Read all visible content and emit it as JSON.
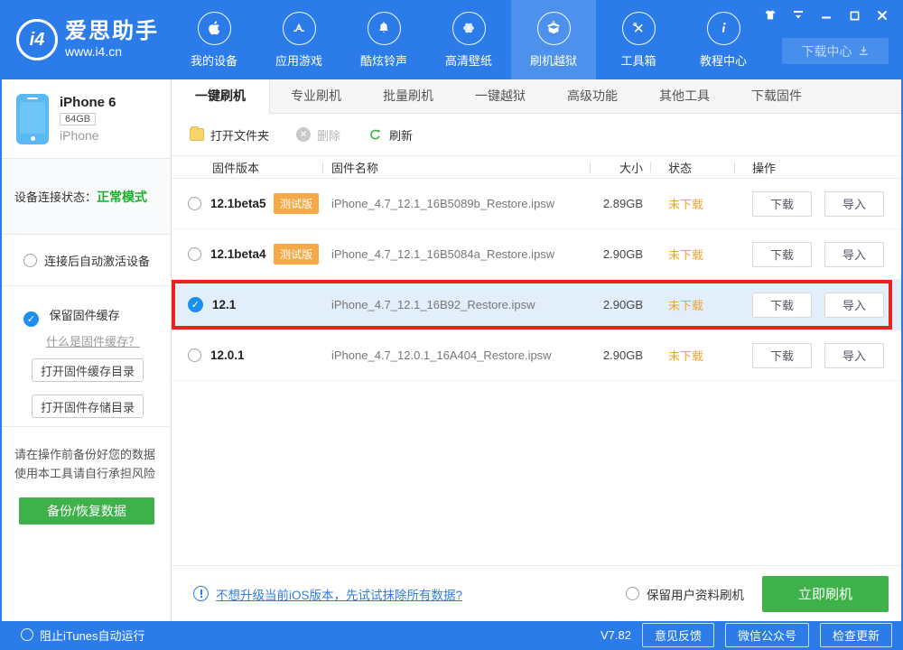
{
  "header": {
    "logo": {
      "badge": "i4",
      "title": "爱思助手",
      "subtitle": "www.i4.cn"
    },
    "nav": [
      {
        "label": "我的设备",
        "icon": "apple-icon"
      },
      {
        "label": "应用游戏",
        "icon": "appstore-icon"
      },
      {
        "label": "酷炫铃声",
        "icon": "bell-icon"
      },
      {
        "label": "高清壁纸",
        "icon": "flower-icon"
      },
      {
        "label": "刷机越狱",
        "icon": "jailbreak-box-icon",
        "active": true
      },
      {
        "label": "工具箱",
        "icon": "toolbox-icon"
      },
      {
        "label": "教程中心",
        "icon": "info-icon"
      }
    ],
    "download_center": "下载中心",
    "window_controls": [
      "skin",
      "collapse",
      "minimize",
      "maximize",
      "close"
    ]
  },
  "sidebar": {
    "device": {
      "name": "iPhone 6",
      "capacity": "64GB",
      "model": "iPhone"
    },
    "connection": {
      "label": "设备连接状态：",
      "status": "正常模式"
    },
    "auto_activate": "连接后自动激活设备",
    "keep_cache": "保留固件缓存",
    "cache_link": "什么是固件缓存？",
    "btn_cache_dir": "打开固件缓存目录",
    "btn_storage_dir": "打开固件存储目录",
    "warning_line1": "请在操作前备份好您的数据",
    "warning_line2": "使用本工具请自行承担风险",
    "backup_btn": "备份/恢复数据"
  },
  "tabs": [
    {
      "label": "一键刷机",
      "active": true
    },
    {
      "label": "专业刷机"
    },
    {
      "label": "批量刷机"
    },
    {
      "label": "一键越狱"
    },
    {
      "label": "高级功能"
    },
    {
      "label": "其他工具"
    },
    {
      "label": "下载固件"
    }
  ],
  "toolbar": {
    "open_folder": "打开文件夹",
    "delete": "删除",
    "refresh": "刷新"
  },
  "table": {
    "headers": [
      "固件版本",
      "固件名称",
      "大小",
      "状态",
      "操作"
    ],
    "download_label": "下载",
    "import_label": "导入",
    "rows": [
      {
        "version": "12.1beta5",
        "beta_label": "测试版",
        "filename": "iPhone_4.7_12.1_16B5089b_Restore.ipsw",
        "size": "2.89GB",
        "status": "未下载",
        "selected": false
      },
      {
        "version": "12.1beta4",
        "beta_label": "测试版",
        "filename": "iPhone_4.7_12.1_16B5084a_Restore.ipsw",
        "size": "2.90GB",
        "status": "未下载",
        "selected": false
      },
      {
        "version": "12.1",
        "filename": "iPhone_4.7_12.1_16B92_Restore.ipsw",
        "size": "2.90GB",
        "status": "未下载",
        "selected": true,
        "highlighted": "red-box"
      },
      {
        "version": "12.0.1",
        "filename": "iPhone_4.7_12.0.1_16A404_Restore.ipsw",
        "size": "2.90GB",
        "status": "未下载",
        "selected": false
      }
    ]
  },
  "footer_actions": {
    "tip_link": "不想升级当前iOS版本，先试试抹除所有数据?",
    "keep_user_data": "保留用户资料刷机",
    "flash_btn": "立即刷机"
  },
  "statusbar": {
    "block_itunes": "阻止iTunes自动运行",
    "version": "V7.82",
    "buttons": [
      "意见反馈",
      "微信公众号",
      "检查更新"
    ]
  },
  "colors": {
    "accent_blue": "#2b7ce9",
    "green_button": "#3fb14a",
    "status_green": "#1cb12a",
    "orange": "#f7a847",
    "annotation_red": "#e8231d",
    "selected_row_bg": "#e3eefb"
  }
}
